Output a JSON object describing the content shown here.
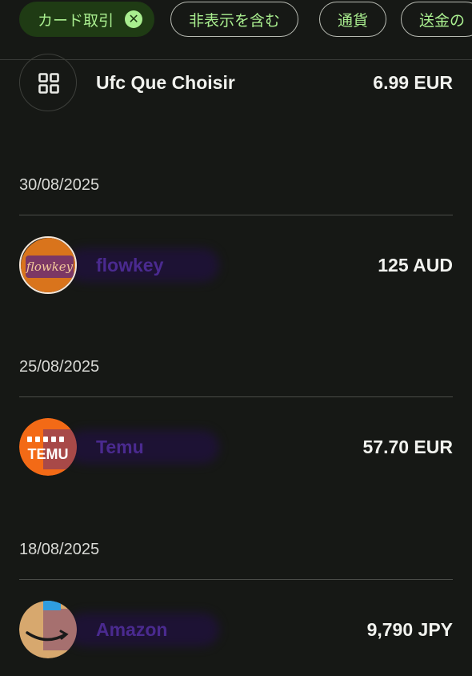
{
  "filters": [
    {
      "label": "カード取引",
      "active": true
    },
    {
      "label": "非表示を含む"
    },
    {
      "label": "通貨"
    },
    {
      "label": "送金の"
    }
  ],
  "chip_close_glyph": "✕",
  "transactions": [
    {
      "merchant": "Ufc Que Choisir",
      "amount": "6.99 EUR",
      "icon": "grid-icon"
    },
    {
      "date": "30/08/2025",
      "merchant": "flowkey",
      "amount": "125 AUD",
      "icon": "flowkey-logo",
      "logo_text": "flowkey"
    },
    {
      "date": "25/08/2025",
      "merchant": "Temu",
      "amount": "57.70 EUR",
      "icon": "temu-logo",
      "logo_text": "TEMU"
    },
    {
      "date": "18/08/2025",
      "merchant": "Amazon",
      "amount": "9,790 JPY",
      "icon": "amazon-logo"
    }
  ],
  "colors": {
    "background": "#161815",
    "chip_text": "#a9ee8f",
    "chip_active_bg": "#1f3b14",
    "flowkey": "#d9741c",
    "temu": "#f36a16",
    "amazon": "#d7a86e"
  }
}
